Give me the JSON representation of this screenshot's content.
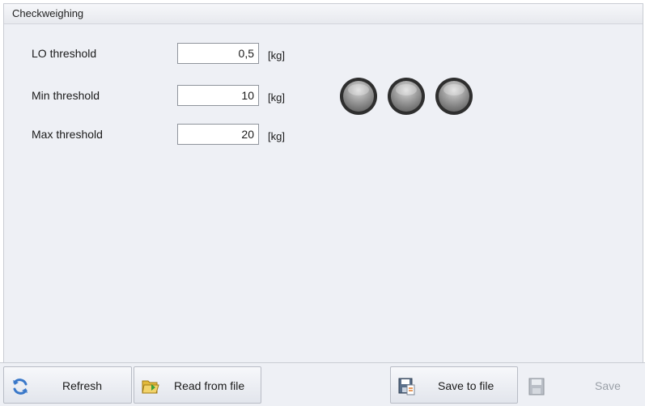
{
  "panel": {
    "title": "Checkweighing"
  },
  "thresholds": [
    {
      "label": "LO threshold",
      "value": "0,5",
      "unit": "[kg]"
    },
    {
      "label": "Min threshold",
      "value": "10",
      "unit": "[kg]"
    },
    {
      "label": "Max threshold",
      "value": "20",
      "unit": "[kg]"
    }
  ],
  "toolbar": {
    "refresh": "Refresh",
    "read_from_file": "Read from file",
    "save_to_file": "Save to file",
    "save": "Save"
  },
  "colors": {
    "refresh_icon": "#3a78c9",
    "folder_icon": "#e2b93b",
    "lamp_off": "#9a9a9a"
  }
}
